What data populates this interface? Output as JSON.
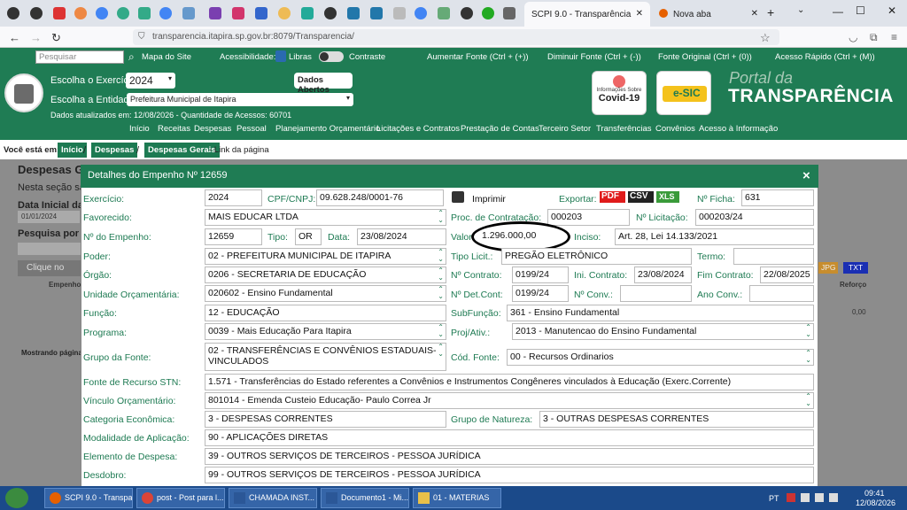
{
  "browser": {
    "tab_active": "SCPI 9.0 - Transparência",
    "tab_new": "Nova aba",
    "url": "transparencia.itapira.sp.gov.br:8079/Transparencia/"
  },
  "header": {
    "search_placeholder": "Pesquisar",
    "sitemap": "Mapa do Site",
    "accessibility": "Acessibilidade:",
    "libras": "Libras",
    "contrast": "Contraste",
    "font_up": "Aumentar Fonte (Ctrl + (+))",
    "font_down": "Diminuir Fonte (Ctrl + (-))",
    "font_orig": "Fonte Original (Ctrl + (0))",
    "quick": "Acesso Rápido (Ctrl + (M))",
    "exercise_label": "Escolha o Exercício:",
    "exercise_value": "2024",
    "entity_label": "Escolha a Entidade:",
    "entity_value": "Prefeitura Municipal de Itapira",
    "open_data": "Dados Abertos",
    "updated": "Dados atualizados em: 12/08/2026 - Quantidade de Acessos: 60701",
    "covid_small": "Informações Sobre",
    "covid": "Covid-19",
    "esic": "e-SIC",
    "portal_small": "Portal da",
    "portal_big": "TRANSPARÊNCIA",
    "menu": [
      "Início",
      "Receitas",
      "Despesas",
      "Pessoal",
      "Planejamento Orçamentário",
      "Licitações e Contratos",
      "Prestação de Contas",
      "Terceiro Setor",
      "Transferências",
      "Convênios",
      "Acesso à Informação"
    ]
  },
  "breadcrumb": {
    "you_are": "Você está em:",
    "items": [
      "Início",
      "Despesas",
      "Despesas Gerais"
    ],
    "tail": "- Link da página"
  },
  "background": {
    "title": "Despesas Ge",
    "title2": "Empenho 2024",
    "line1": "Nesta seção sã",
    "line2": "Data Inicial da",
    "date": "01/01/2024",
    "search": "Pesquisa por hi",
    "click": "Clique no",
    "col1": "Empenho",
    "col2": "Reforço",
    "zero": "0,00",
    "showing": "Mostrando página",
    "jpg": "JPG",
    "txt": "TXT"
  },
  "modal": {
    "title": "Detalhes do Empenho Nº 12659",
    "close": "×",
    "print": "Imprimir",
    "export": "Exportar:",
    "pdf": "PDF",
    "csv": "CSV",
    "xls": "XLS",
    "f": {
      "exercicio_l": "Exercício:",
      "exercicio": "2024",
      "cpf_l": "CPF/CNPJ:",
      "cpf": "09.628.248/0001-76",
      "ficha_l": "Nº Ficha:",
      "ficha": "631",
      "favorecido_l": "Favorecido:",
      "favorecido": "MAIS EDUCAR LTDA",
      "proc_l": "Proc. de Contratação:",
      "proc": "000203",
      "licit_l": "Nº Licitação:",
      "licit": "000203/24",
      "empenho_l": "Nº do Empenho:",
      "empenho": "12659",
      "tipo_l": "Tipo:",
      "tipo": "OR",
      "data_l": "Data:",
      "data": "23/08/2024",
      "valor_l": "Valor:",
      "valor": "1.296.000,00",
      "inciso_l": "Inciso:",
      "inciso": "Art. 28, Lei 14.133/2021",
      "poder_l": "Poder:",
      "poder": "02 - PREFEITURA MUNICIPAL DE ITAPIRA",
      "tipolicit_l": "Tipo Licit.:",
      "tipolicit": "PREGÃO ELETRÔNICO",
      "termo_l": "Termo:",
      "termo": "",
      "orgao_l": "Órgão:",
      "orgao": "0206 - SECRETARIA DE EDUCAÇÃO",
      "contrato_l": "Nº Contrato:",
      "contrato": "0199/24",
      "inicontr_l": "Ini. Contrato:",
      "inicontr": "23/08/2024",
      "fimcontr_l": "Fim Contrato:",
      "fimcontr": "22/08/2025",
      "unidade_l": "Unidade Orçamentária:",
      "unidade": "020602 - Ensino Fundamental",
      "detcont_l": "Nº Det.Cont:",
      "detcont": "0199/24",
      "conv_l": "Nº Conv.:",
      "conv": "",
      "anoconv_l": "Ano Conv.:",
      "anoconv": "",
      "funcao_l": "Função:",
      "funcao": "12 - EDUCAÇÃO",
      "subfuncao_l": "SubFunção:",
      "subfuncao": "361 - Ensino Fundamental",
      "programa_l": "Programa:",
      "programa": "0039 - Mais Educação Para Itapira",
      "projativ_l": "Proj/Ativ.:",
      "projativ": "2013 - Manutencao do Ensino Fundamental",
      "grupofonte_l": "Grupo da Fonte:",
      "grupofonte": "02 - TRANSFERÊNCIAS E CONVÊNIOS ESTADUAIS-",
      "grupofonte2": "VINCULADOS",
      "codfonte_l": "Cód. Fonte:",
      "codfonte": "00 - Recursos Ordinarios",
      "stn_l": "Fonte de Recurso STN:",
      "stn": "1.571 - Transferências do Estado referentes a Convênios e Instrumentos Congêneres vinculados à Educação (Exerc.Corrente)",
      "vinculo_l": "Vínculo Orçamentário:",
      "vinculo": "801014 - Emenda Custeio Educação- Paulo Correa Jr",
      "categoria_l": "Categoria Econômica:",
      "categoria": "3 - DESPESAS CORRENTES",
      "natureza_l": "Grupo de Natureza:",
      "natureza": "3 - OUTRAS DESPESAS CORRENTES",
      "modalidade_l": "Modalidade de Aplicação:",
      "modalidade": "90 - APLICAÇÕES DIRETAS",
      "elemento_l": "Elemento de Despesa:",
      "elemento": "39 - OUTROS SERVIÇOS DE TERCEIROS - PESSOA JURÍDICA",
      "desdobro_l": "Desdobro:",
      "desdobro": "99 - OUTROS SERVIÇOS DE TERCEIROS - PESSOA JURÍDICA"
    }
  },
  "taskbar": {
    "items": [
      "SCPI 9.0 - Transpa...",
      "post - Post para l...",
      "CHAMADA INST...",
      "Documento1 - Mi...",
      "01 - MATERIAS"
    ],
    "lang": "PT",
    "time": "09:41",
    "date": "12/08/2026"
  }
}
